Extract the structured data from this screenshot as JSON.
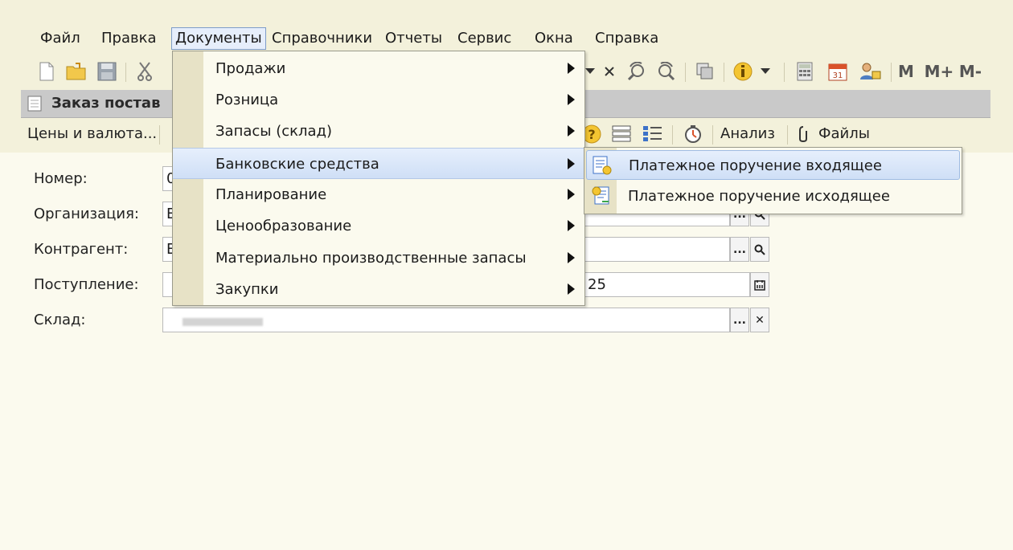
{
  "menubar": {
    "items": [
      {
        "label": "Файл"
      },
      {
        "label": "Правка"
      },
      {
        "label": "Документы"
      },
      {
        "label": "Справочники"
      },
      {
        "label": "Отчеты"
      },
      {
        "label": "Сервис"
      },
      {
        "label": "Окна"
      },
      {
        "label": "Справка"
      }
    ]
  },
  "toolbar": {
    "m_label": "M",
    "mplus_label": "M+",
    "mminus_label": "M-"
  },
  "window": {
    "title": "Заказ постав"
  },
  "doc_toolbar": {
    "prices_label": "Цены и валюта...",
    "analysis_label": "Анализ",
    "files_label": "Файлы"
  },
  "form": {
    "number_label": "Номер:",
    "number_value": "0",
    "organization_label": "Организация:",
    "organization_value": "Б",
    "counterparty_label": "Контрагент:",
    "counterparty_value": "Б",
    "receipt_label": "Поступление:",
    "receipt_value": "25",
    "warehouse_label": "Склад:",
    "ellipsis": "...",
    "clear": "✕"
  },
  "dropdown": {
    "items": [
      {
        "label": "Продажи"
      },
      {
        "label": "Розница"
      },
      {
        "label": "Запасы (склад)"
      },
      {
        "label": "Банковские средства"
      },
      {
        "label": "Планирование"
      },
      {
        "label": "Ценообразование"
      },
      {
        "label": "Материально производственные запасы"
      },
      {
        "label": "Закупки"
      }
    ]
  },
  "submenu": {
    "items": [
      {
        "label": "Платежное поручение входящее"
      },
      {
        "label": "Платежное поручение исходящее"
      }
    ]
  }
}
